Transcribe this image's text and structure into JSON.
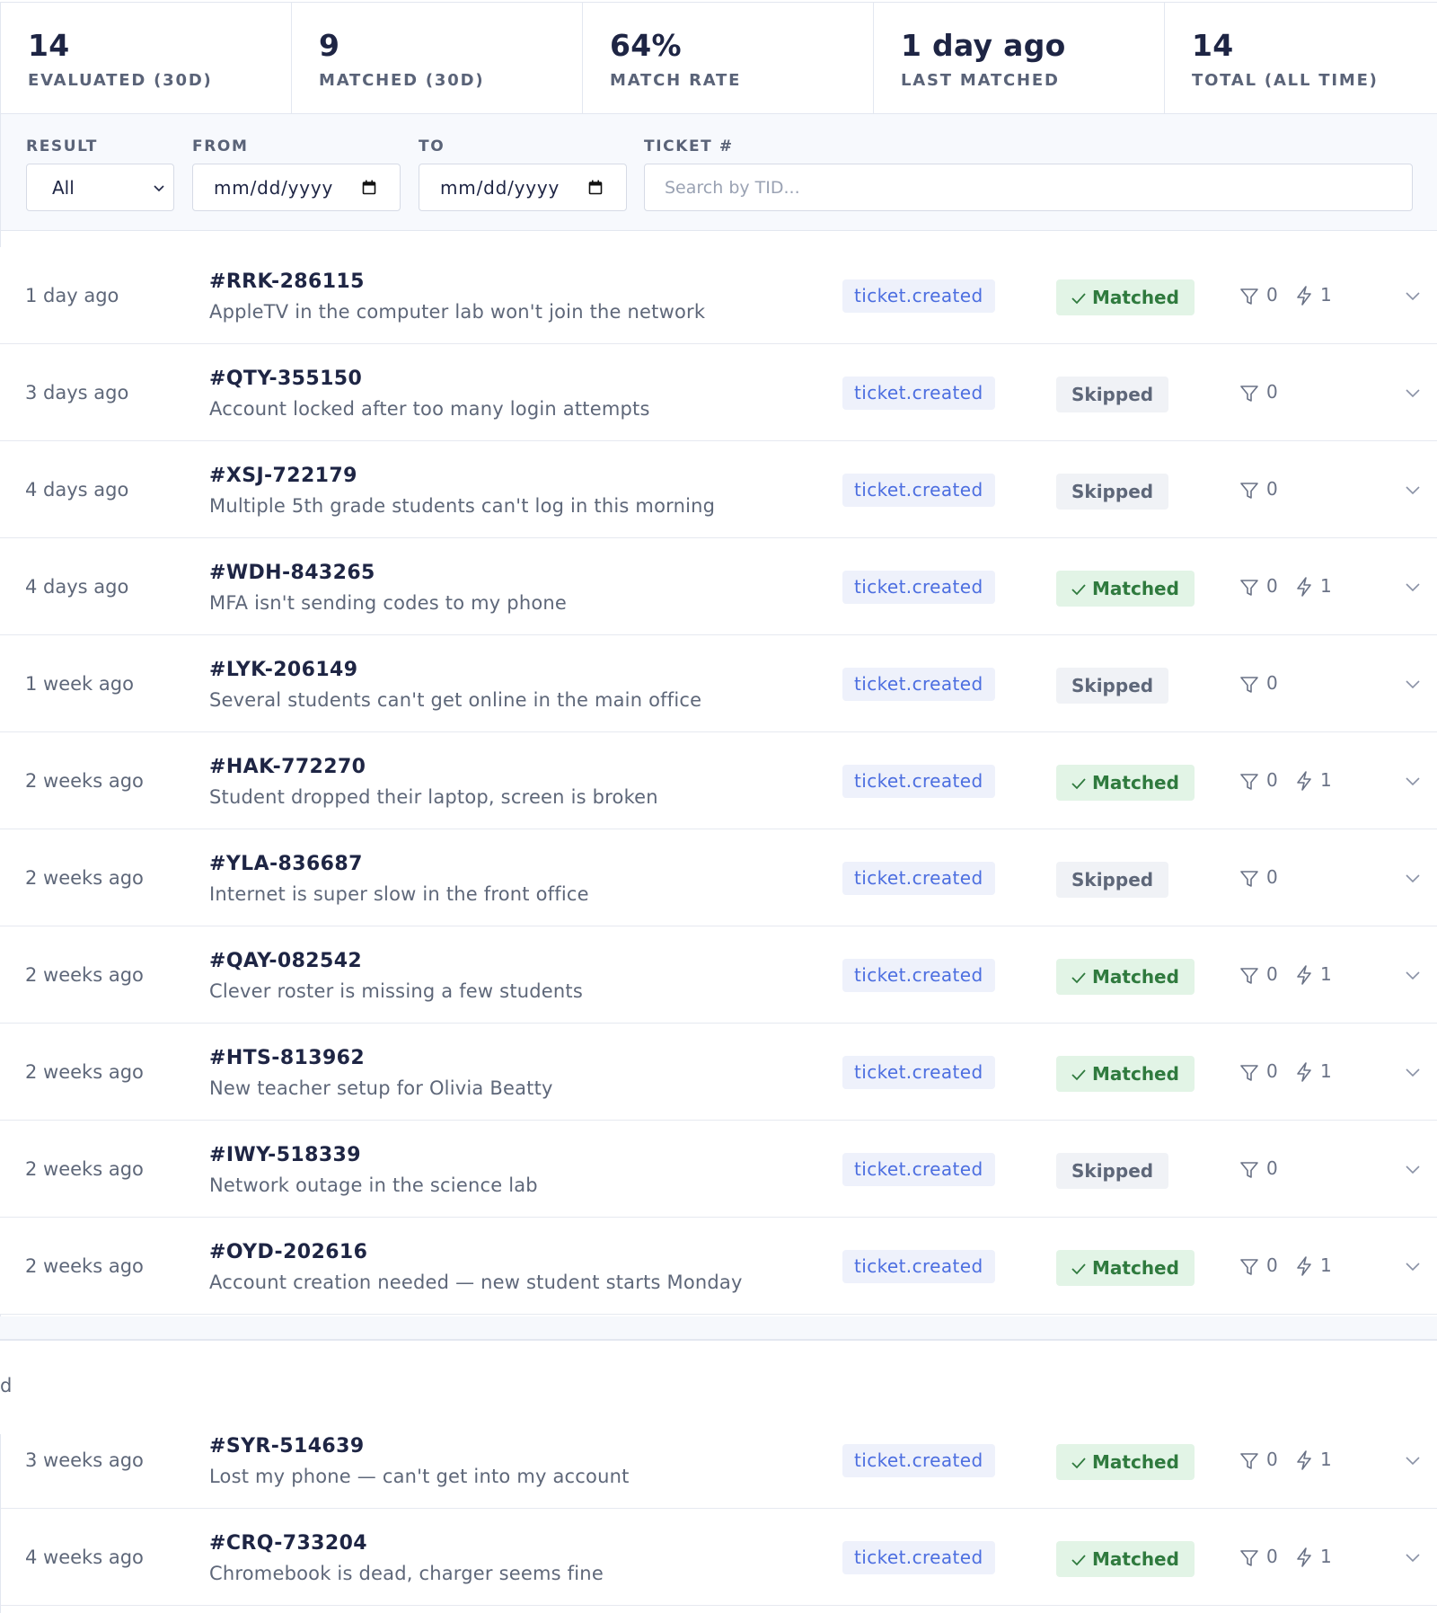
{
  "stats": [
    {
      "value": "14",
      "label": "EVALUATED (30D)"
    },
    {
      "value": "9",
      "label": "MATCHED (30D)"
    },
    {
      "value": "64%",
      "label": "MATCH RATE"
    },
    {
      "value": "1 day ago",
      "label": "LAST MATCHED"
    },
    {
      "value": "14",
      "label": "TOTAL (ALL TIME)"
    }
  ],
  "filters": {
    "result_label": "RESULT",
    "result_value": "All",
    "from_label": "FROM",
    "from_value": "mm/dd/yyyy",
    "to_label": "TO",
    "to_value": "mm/dd/yyyy",
    "ticket_label": "TICKET #",
    "ticket_placeholder": "Search by TID..."
  },
  "rows": [
    {
      "time": "1 day ago",
      "tid": "#RRK-286115",
      "summary": "AppleTV in the computer lab won't join the network",
      "event": "ticket.created",
      "result": "Matched",
      "filters": "0",
      "actions": "1"
    },
    {
      "time": "3 days ago",
      "tid": "#QTY-355150",
      "summary": "Account locked after too many login attempts",
      "event": "ticket.created",
      "result": "Skipped",
      "filters": "0",
      "actions": ""
    },
    {
      "time": "4 days ago",
      "tid": "#XSJ-722179",
      "summary": "Multiple 5th grade students can't log in this morning",
      "event": "ticket.created",
      "result": "Skipped",
      "filters": "0",
      "actions": ""
    },
    {
      "time": "4 days ago",
      "tid": "#WDH-843265",
      "summary": "MFA isn't sending codes to my phone",
      "event": "ticket.created",
      "result": "Matched",
      "filters": "0",
      "actions": "1"
    },
    {
      "time": "1 week ago",
      "tid": "#LYK-206149",
      "summary": "Several students can't get online in the main office",
      "event": "ticket.created",
      "result": "Skipped",
      "filters": "0",
      "actions": ""
    },
    {
      "time": "2 weeks ago",
      "tid": "#HAK-772270",
      "summary": "Student dropped their laptop, screen is broken",
      "event": "ticket.created",
      "result": "Matched",
      "filters": "0",
      "actions": "1"
    },
    {
      "time": "2 weeks ago",
      "tid": "#YLA-836687",
      "summary": "Internet is super slow in the front office",
      "event": "ticket.created",
      "result": "Skipped",
      "filters": "0",
      "actions": ""
    },
    {
      "time": "2 weeks ago",
      "tid": "#QAY-082542",
      "summary": "Clever roster is missing a few students",
      "event": "ticket.created",
      "result": "Matched",
      "filters": "0",
      "actions": "1"
    },
    {
      "time": "2 weeks ago",
      "tid": "#HTS-813962",
      "summary": "New teacher setup for Olivia Beatty",
      "event": "ticket.created",
      "result": "Matched",
      "filters": "0",
      "actions": "1"
    },
    {
      "time": "2 weeks ago",
      "tid": "#IWY-518339",
      "summary": "Network outage in the science lab",
      "event": "ticket.created",
      "result": "Skipped",
      "filters": "0",
      "actions": ""
    },
    {
      "time": "2 weeks ago",
      "tid": "#OYD-202616",
      "summary": "Account creation needed — new student starts Monday",
      "event": "ticket.created",
      "result": "Matched",
      "filters": "0",
      "actions": "1"
    },
    {
      "time": "3 weeks ago",
      "tid": "#SYR-514639",
      "summary": "Lost my phone — can't get into my account",
      "event": "ticket.created",
      "result": "Matched",
      "filters": "0",
      "actions": "1"
    },
    {
      "time": "4 weeks ago",
      "tid": "#CRQ-733204",
      "summary": "Chromebook is dead, charger seems fine",
      "event": "ticket.created",
      "result": "Matched",
      "filters": "0",
      "actions": "1"
    }
  ],
  "stray_text": "d",
  "icons": {
    "result_select": "chevron-down-icon",
    "date_picker": "calendar-icon",
    "matched": "check-icon",
    "filters": "filter-icon",
    "actions": "bolt-icon",
    "expand": "chevron-down-icon"
  },
  "colors": {
    "event_badge_bg": "#eef1fb",
    "event_badge_text": "#4c6ee0",
    "matched_bg": "#e2f4e6",
    "matched_text": "#2f7a3e",
    "skipped_bg": "#f0f2f6",
    "skipped_text": "#5e6779"
  }
}
